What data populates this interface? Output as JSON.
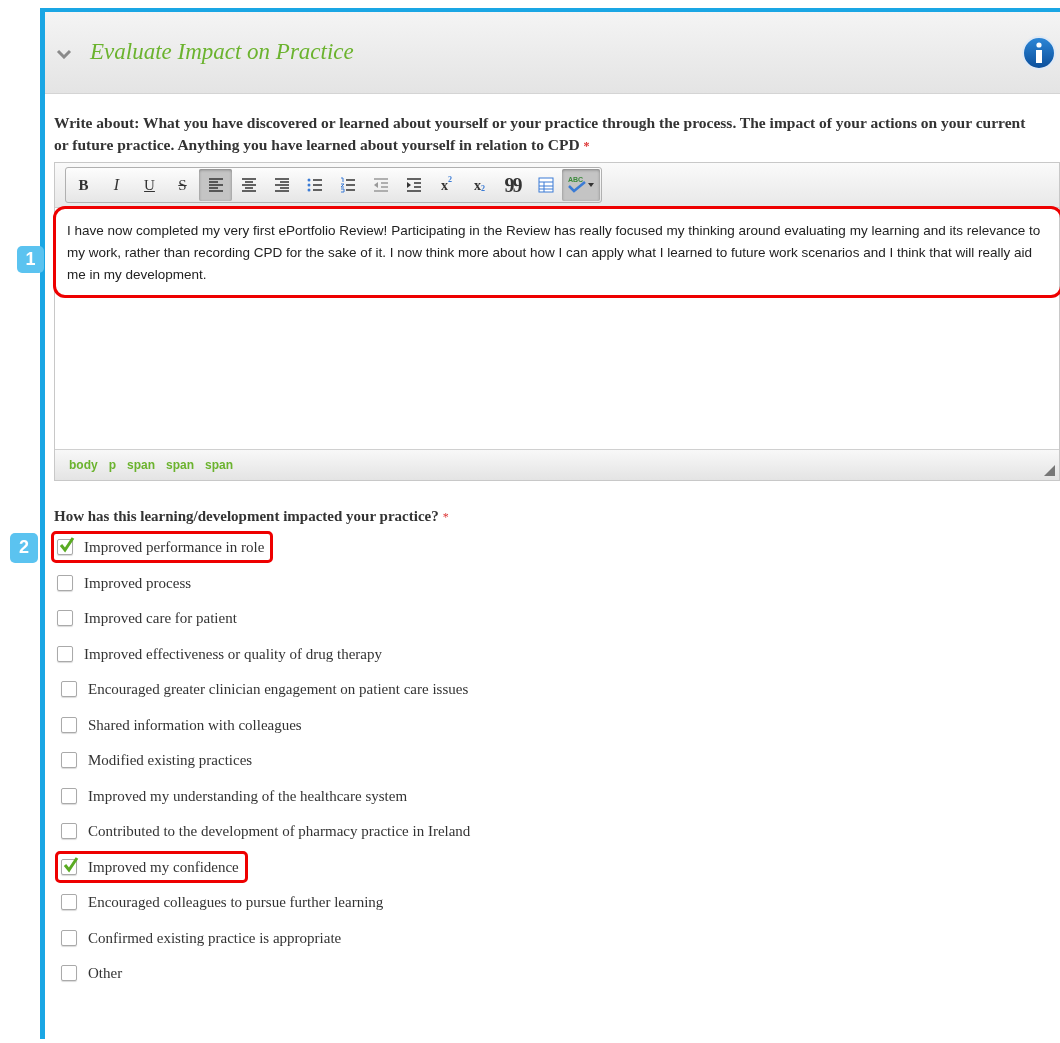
{
  "section": {
    "title": "Evaluate Impact on Practice",
    "expanded": true
  },
  "question_1": {
    "label": "Write about: What you have discovered or learned about yourself or your practice through the process. The impact of your actions on your current or future practice. Anything you have learned about yourself in relation to CPD",
    "required_mark": "*"
  },
  "toolbar": [
    {
      "kind": "bold",
      "label": "B",
      "active": false
    },
    {
      "kind": "italic",
      "label": "I",
      "active": false
    },
    {
      "kind": "underline",
      "label": "U",
      "active": false
    },
    {
      "kind": "strike",
      "label": "S",
      "active": false
    },
    {
      "kind": "align-left",
      "active": true
    },
    {
      "kind": "align-center",
      "active": false
    },
    {
      "kind": "align-right",
      "active": false
    },
    {
      "kind": "bullets",
      "active": false
    },
    {
      "kind": "numbers",
      "active": false
    },
    {
      "kind": "outdent",
      "active": false
    },
    {
      "kind": "indent",
      "active": false
    },
    {
      "kind": "sup",
      "label": "x",
      "mark": "2",
      "active": false
    },
    {
      "kind": "sub",
      "label": "x",
      "mark": "2",
      "active": false
    },
    {
      "kind": "quote",
      "label": "99",
      "active": false
    },
    {
      "kind": "table",
      "active": false
    },
    {
      "kind": "spell",
      "label": "ABC",
      "active": true
    }
  ],
  "editor": {
    "value": "I have now completed my very first ePortfolio Review! Participating in the Review has really focused my thinking around evaluating my learning and its relevance to my work, rather than recording CPD for the sake of it. I now think more about how I can apply what I learned to future work scenarios and I think that will really aid me in my development.",
    "highlighted": true,
    "callout": "1"
  },
  "path": [
    "body",
    "p",
    "span",
    "span",
    "span"
  ],
  "question_2": {
    "label": "How has this learning/development impacted your practice?",
    "required_mark": "*"
  },
  "options": [
    {
      "label": "Improved performance in role",
      "checked": true,
      "highlighted": true,
      "callout": "2"
    },
    {
      "label": "Improved process",
      "checked": false,
      "highlighted": false
    },
    {
      "label": "Improved care for patient",
      "checked": false,
      "highlighted": false
    },
    {
      "label": "Improved effectiveness or quality of drug therapy",
      "checked": false,
      "highlighted": false
    },
    {
      "label": "Encouraged greater clinician engagement on patient care issues",
      "checked": false,
      "highlighted": false
    },
    {
      "label": "Shared information with colleagues",
      "checked": false,
      "highlighted": false
    },
    {
      "label": "Modified existing practices",
      "checked": false,
      "highlighted": false
    },
    {
      "label": "Improved my understanding of the healthcare system",
      "checked": false,
      "highlighted": false
    },
    {
      "label": "Contributed to the development of pharmacy practice in Ireland",
      "checked": false,
      "highlighted": false
    },
    {
      "label": "Improved my confidence",
      "checked": true,
      "highlighted": true
    },
    {
      "label": "Encouraged colleagues to pursue further learning",
      "checked": false,
      "highlighted": false
    },
    {
      "label": "Confirmed existing practice is appropriate",
      "checked": false,
      "highlighted": false
    },
    {
      "label": "Other",
      "checked": false,
      "highlighted": false
    }
  ]
}
